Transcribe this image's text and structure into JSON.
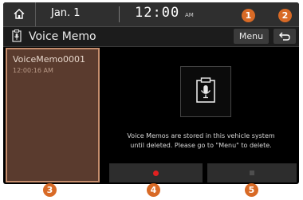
{
  "status_bar": {
    "home_icon": "home-icon",
    "date": "Jan. 1",
    "time": "12:00",
    "ampm": "AM"
  },
  "title_bar": {
    "icon": "voice-memo-icon",
    "title": "Voice Memo",
    "menu_label": "Menu",
    "back_icon": "back-icon"
  },
  "memo_list": [
    {
      "name": "VoiceMemo0001",
      "time": "12:00:16 AM"
    }
  ],
  "main": {
    "icon": "microphone-clipboard-icon",
    "info_line1": "Voice Memos are stored in this vehicle system",
    "info_line2": "until deleted. Please go to \"Menu\" to delete."
  },
  "controls": {
    "record_icon": "record-icon",
    "stop_icon": "stop-icon"
  },
  "callouts": [
    "1",
    "2",
    "3",
    "4",
    "5"
  ],
  "colors": {
    "callout": "#d86a26",
    "selected_item_bg": "#5a3b2e",
    "selected_item_border": "#c58d6d",
    "record": "#e02020"
  }
}
